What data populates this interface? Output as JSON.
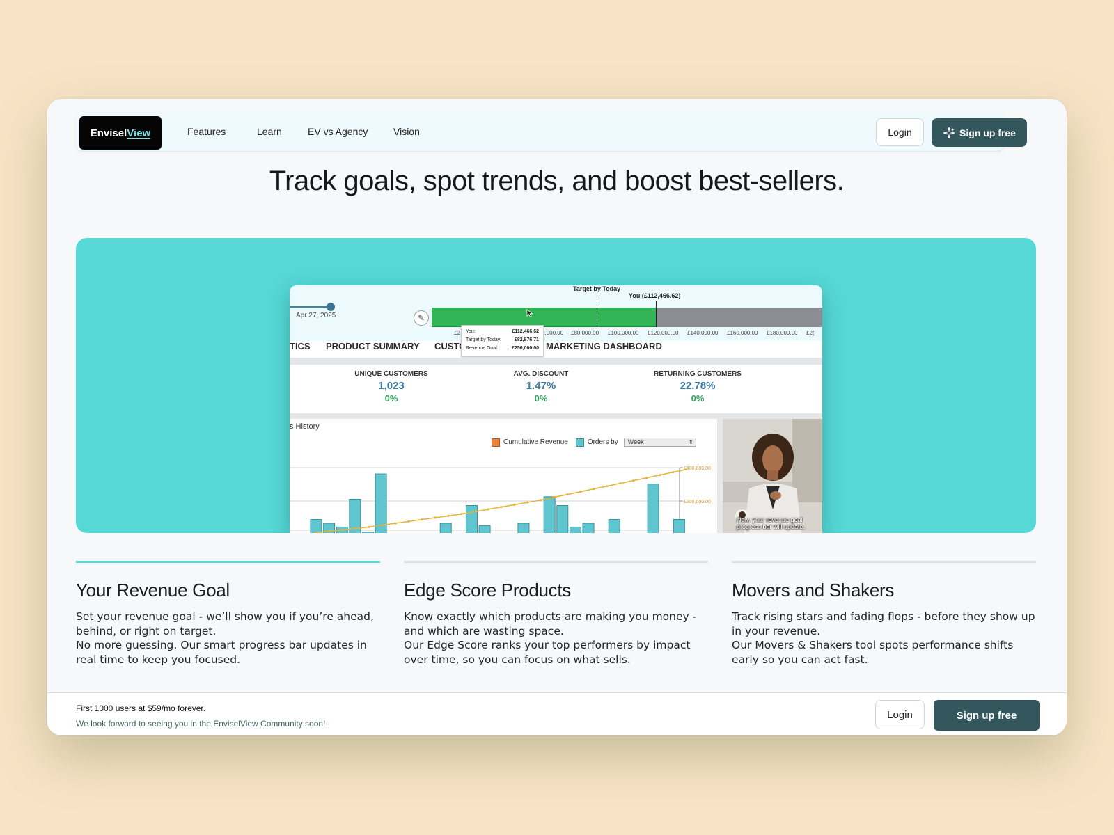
{
  "nav": {
    "logo_part1": "Envisel",
    "logo_part2": "View",
    "links": [
      "Features",
      "Learn",
      "EV vs Agency",
      "Vision"
    ],
    "login": "Login",
    "signup": "Sign up free"
  },
  "hero": {
    "title": "Track goals, spot trends, and boost best-sellers."
  },
  "dashboard": {
    "date": "Apr 27, 2025",
    "target_label": "Target by Today",
    "you_label": "You (£112,466.62)",
    "axis_ticks": [
      "£2",
      "0,000.00",
      "£80,000.00",
      "£100,000.00",
      "£120,000.00",
      "£140,000.00",
      "£160,000.00",
      "£180,000.00",
      "£2("
    ],
    "progress": {
      "you": 112466.62,
      "target_today": 82876.71,
      "goal": 250000.0
    },
    "tooltip": [
      {
        "label": "You:",
        "value": "£112,466.62"
      },
      {
        "label": "Target by Today:",
        "value": "£82,876.71"
      },
      {
        "label": "Revenue Goal:",
        "value": "£250,000.00"
      }
    ],
    "tabs": [
      "TICS",
      "PRODUCT SUMMARY",
      "CUSTO",
      "MARKETING DASHBOARD"
    ],
    "kpis": [
      {
        "label": "UNIQUE CUSTOMERS",
        "value": "1,023",
        "change": "0%"
      },
      {
        "label": "AVG. DISCOUNT",
        "value": "1.47%",
        "change": "0%"
      },
      {
        "label": "RETURNING CUSTOMERS",
        "value": "22.78%",
        "change": "0%"
      }
    ],
    "chart_title": "s History",
    "legend_revenue": "Cumulative Revenue",
    "legend_orders": "Orders by",
    "period_select": "Week",
    "video_caption": "Now, your revenue goal progress bar will update.",
    "colors": {
      "revenue": "#e8823a",
      "orders": "#5fc6cf",
      "progress_green": "#32b556"
    }
  },
  "chart_data": {
    "type": "bar",
    "series": [
      {
        "name": "Orders by",
        "values": [
          14,
          11,
          8,
          30,
          4,
          50,
          0,
          0,
          0,
          0,
          11,
          0,
          25,
          9,
          0,
          0,
          11,
          0,
          32,
          25,
          8,
          11,
          0,
          14,
          0,
          0,
          42,
          0,
          14
        ]
      },
      {
        "name": "Cumulative Revenue",
        "values": [
          260000,
          263000,
          266000,
          269000,
          272000,
          276000,
          280000,
          284000,
          288000,
          292000,
          296000,
          300000,
          305000,
          310000,
          315000,
          320000,
          325000,
          330000,
          336000,
          342000,
          348000,
          354000,
          360000,
          366000,
          372000,
          378000,
          384000,
          390000,
          396000
        ]
      }
    ],
    "y2_ticks": [
      "£400,000.00",
      "£300,000.00"
    ]
  },
  "features": [
    {
      "title": "Your Revenue Goal",
      "line1": "Set your revenue goal - we’ll show you if you’re ahead, behind, or right on target.",
      "line2": "No more guessing. Our smart progress bar updates in real time to keep you focused."
    },
    {
      "title": "Edge Score Products",
      "line1": "Know exactly which products are making you money - and which are wasting space.",
      "line2": "Our Edge Score ranks your top performers by impact over time, so you can focus on what sells."
    },
    {
      "title": "Movers and Shakers",
      "line1": "Track rising stars and fading flops - before they show up in your revenue.",
      "line2": "Our Movers & Shakers tool spots performance shifts early so you can act fast."
    }
  ],
  "footer": {
    "offer": "First 1000 users at $59/mo forever.",
    "note": "We look forward to seeing you in the EnviselView Community soon!",
    "login": "Login",
    "signup": "Sign up free"
  }
}
